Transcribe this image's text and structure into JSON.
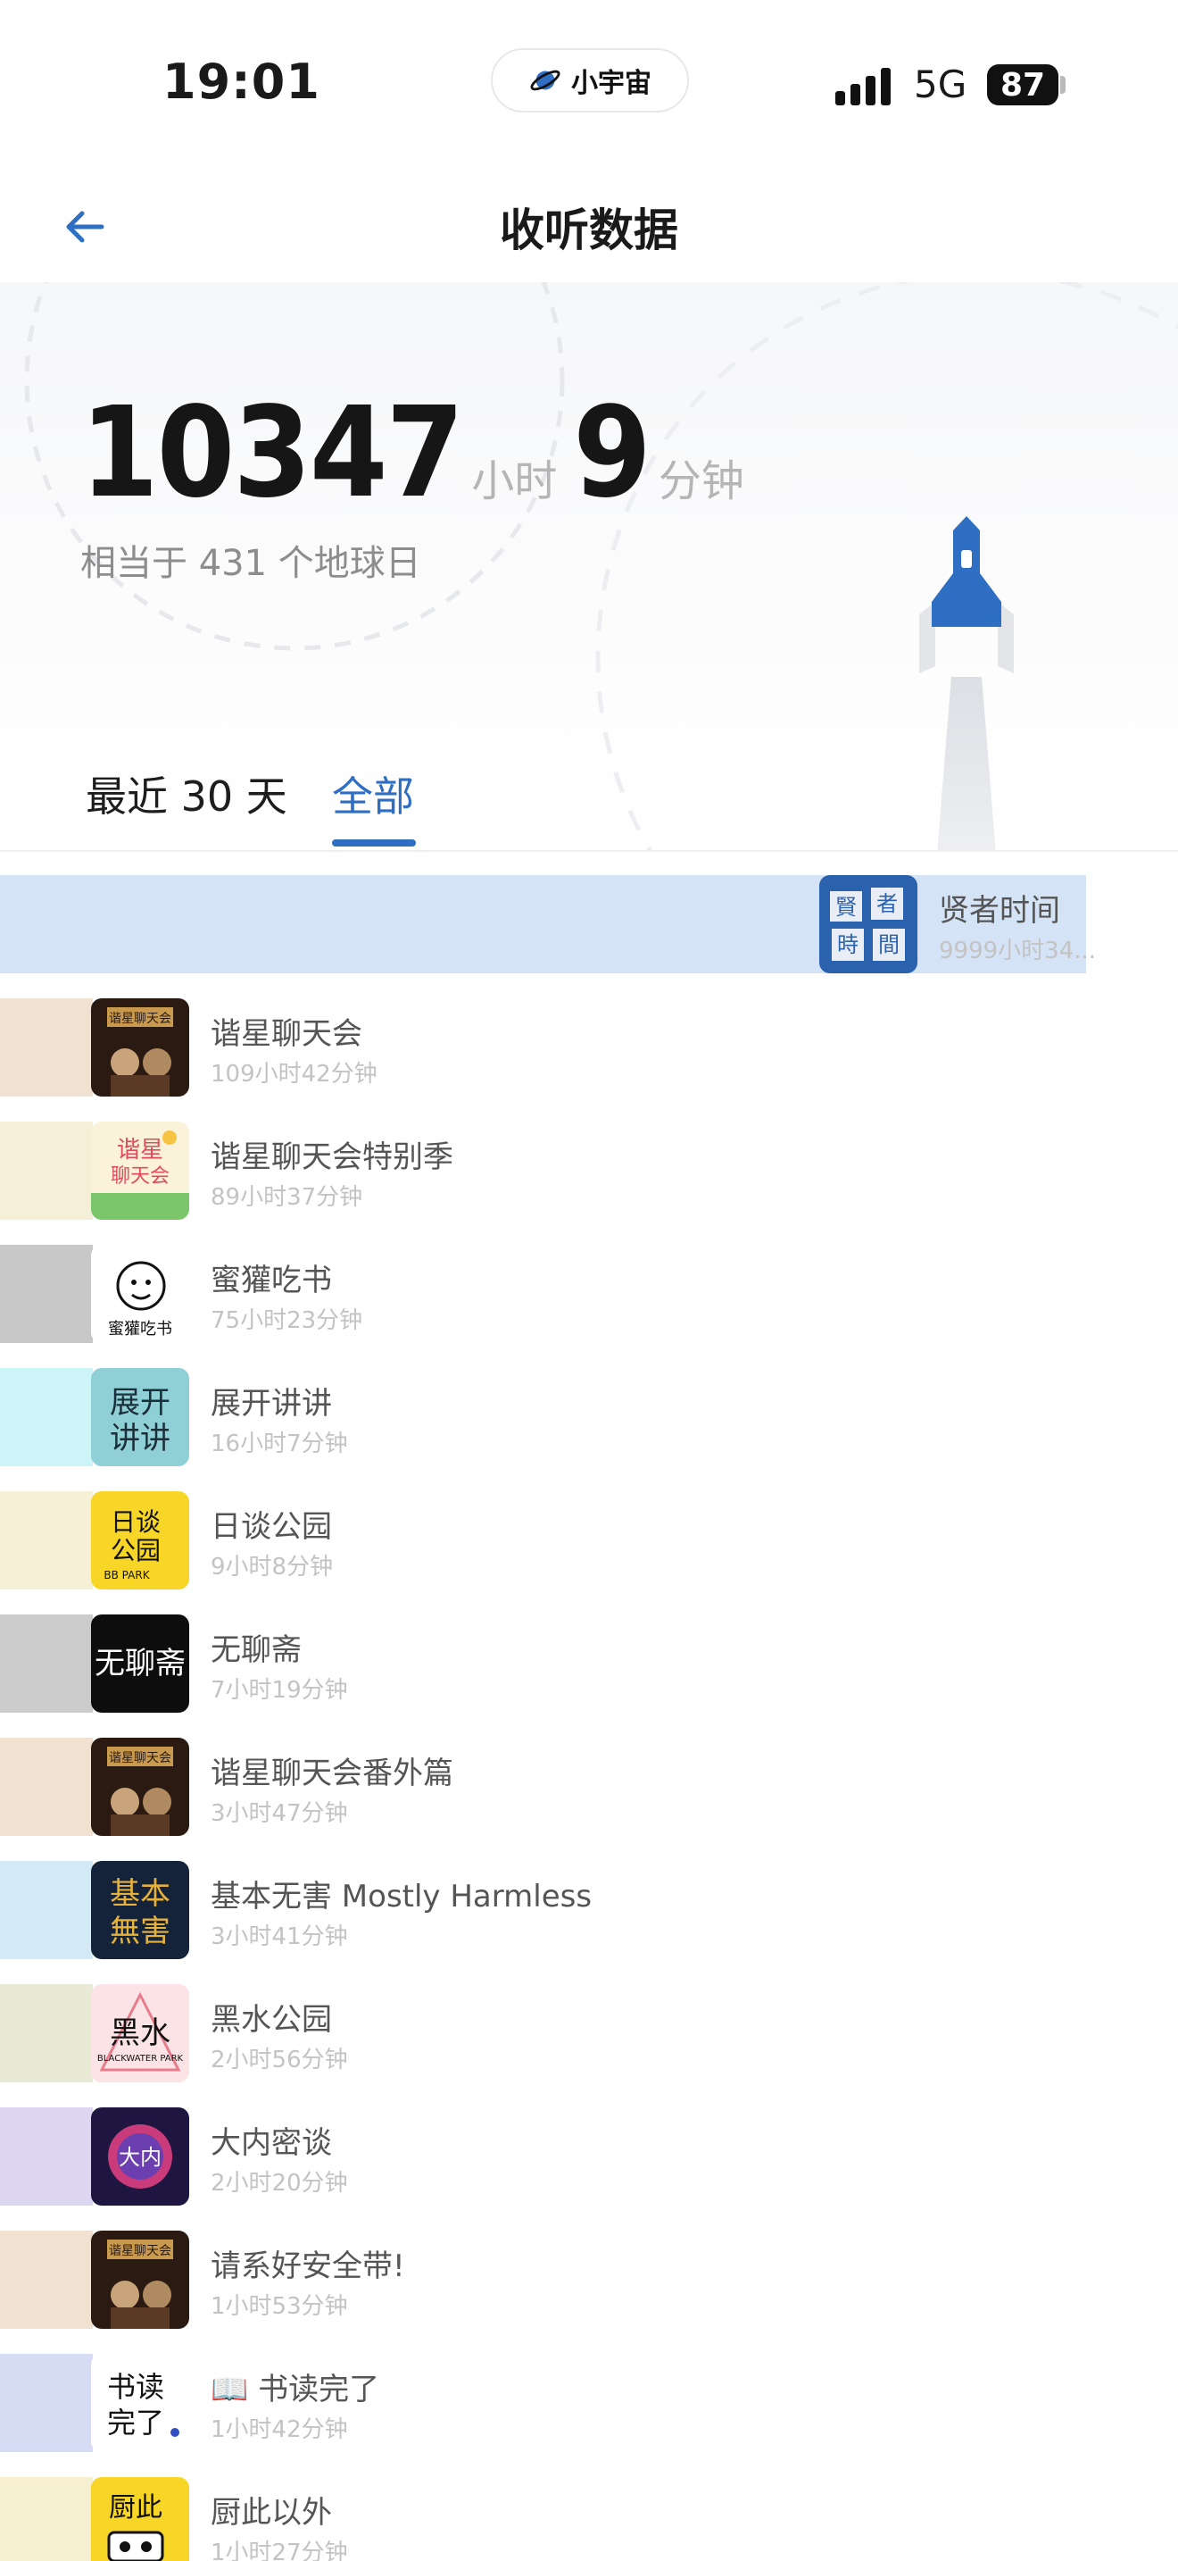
{
  "status_bar": {
    "time": "19:01",
    "island_label": "小宇宙",
    "network": "5G",
    "battery": "87"
  },
  "nav": {
    "title": "收听数据"
  },
  "hero": {
    "hours": "10347",
    "hours_unit": "小时",
    "minutes": "9",
    "minutes_unit": "分钟",
    "equivalent": "相当于 431 个地球日"
  },
  "tabs": [
    {
      "label": "最近 30 天",
      "selected": false
    },
    {
      "label": "全部",
      "selected": true
    }
  ],
  "colors": {
    "accent": "#2f6fc3",
    "rocket": "#2f6fc3"
  },
  "podcasts": [
    {
      "title": "贤者时间",
      "duration": "9999小时34...",
      "bar_fraction": 0.96,
      "bar_color": "#d4e3f5",
      "icon": "xianzhe-cover"
    },
    {
      "title": "谐星聊天会",
      "duration": "109小时42分钟",
      "bar_fraction": 0.0106,
      "bar_color": "#f0e1d0",
      "icon": "xiexing-cover"
    },
    {
      "title": "谐星聊天会特别季",
      "duration": "89小时37分钟",
      "bar_fraction": 0.0087,
      "bar_color": "#f4efd6",
      "icon": "xiexing-special-cover"
    },
    {
      "title": "蜜獾吃书",
      "duration": "75小时23分钟",
      "bar_fraction": 0.0073,
      "bar_color": "#c8c8c8",
      "icon": "mihuan-cover"
    },
    {
      "title": "展开讲讲",
      "duration": "16小时7分钟",
      "bar_fraction": 0.0016,
      "bar_color": "#cdf4f6",
      "icon": "zhankai-cover"
    },
    {
      "title": "日谈公园",
      "duration": "9小时8分钟",
      "bar_fraction": 0.0009,
      "bar_color": "#f6f1d6",
      "icon": "ritan-cover"
    },
    {
      "title": "无聊斋",
      "duration": "7小时19分钟",
      "bar_fraction": 0.0007,
      "bar_color": "#cccccc",
      "icon": "wuliaozhai-cover"
    },
    {
      "title": "谐星聊天会番外篇",
      "duration": "3小时47分钟",
      "bar_fraction": 0.0004,
      "bar_color": "#f0e1d0",
      "icon": "xiexing-extra-cover"
    },
    {
      "title": "基本无害 Mostly Harmless",
      "duration": "3小时41分钟",
      "bar_fraction": 0.0004,
      "bar_color": "#d3eaf6",
      "icon": "jiben-cover"
    },
    {
      "title": "黑水公园",
      "duration": "2小时56分钟",
      "bar_fraction": 0.0003,
      "bar_color": "#e9ead6",
      "icon": "heishui-cover"
    },
    {
      "title": "大内密谈",
      "duration": "2小时20分钟",
      "bar_fraction": 0.0002,
      "bar_color": "#ddd6f2",
      "icon": "danei-cover"
    },
    {
      "title": "请系好安全带!",
      "duration": "1小时53分钟",
      "bar_fraction": 0.0002,
      "bar_color": "#f0e1d0",
      "icon": "anquandai-cover"
    },
    {
      "title": "📖 书读完了",
      "duration": "1小时42分钟",
      "bar_fraction": 0.0002,
      "bar_color": "#d7dcf5",
      "icon": "shudu-cover"
    },
    {
      "title": "厨此以外",
      "duration": "1小时27分钟",
      "bar_fraction": 0.0001,
      "bar_color": "#f6f0d0",
      "icon": "chuci-cover"
    }
  ]
}
